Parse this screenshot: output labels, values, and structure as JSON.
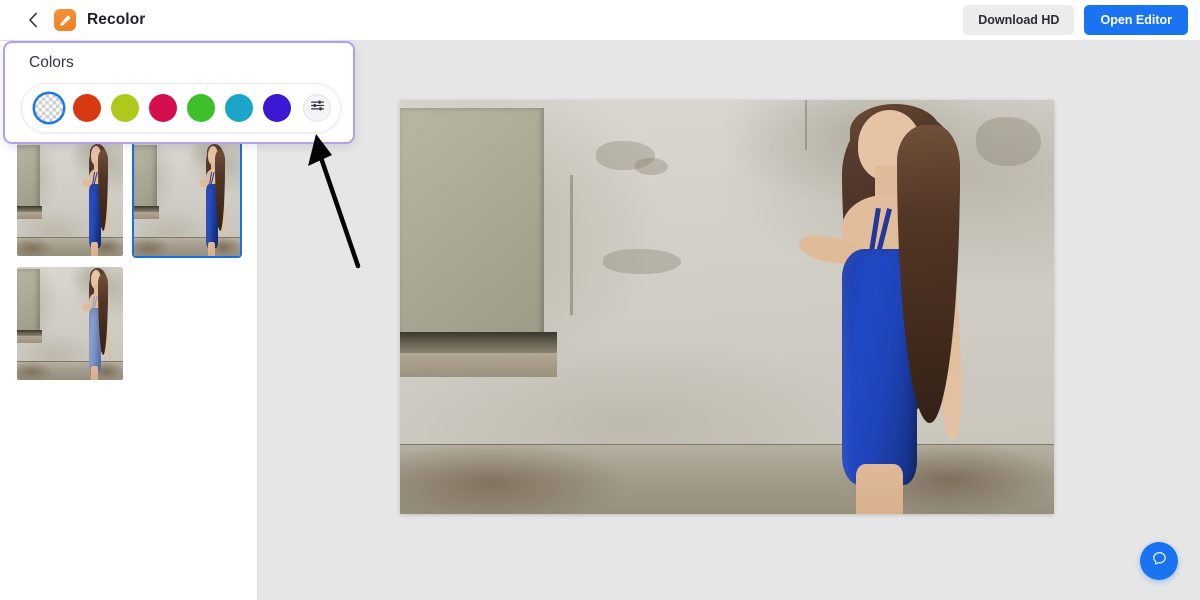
{
  "header": {
    "back_icon": "chevron-left-icon",
    "logo_icon": "paint-brush-icon",
    "app_title": "Recolor",
    "download_label": "Download HD",
    "open_editor_label": "Open Editor",
    "primary_color": "#1a73f0",
    "secondary_bg": "#ececec",
    "logo_color": "#ef7e24"
  },
  "colors_panel": {
    "title": "Colors",
    "border_color": "#b49ef0",
    "settings_icon": "sliders-icon",
    "selected_index": 0,
    "swatches": [
      {
        "name": "transparent",
        "hex": "transparent",
        "selected": true
      },
      {
        "name": "red-orange",
        "hex": "#d73a12",
        "selected": false
      },
      {
        "name": "yellow-green",
        "hex": "#aec91b",
        "selected": false
      },
      {
        "name": "crimson-pink",
        "hex": "#d50f4e",
        "selected": false
      },
      {
        "name": "green",
        "hex": "#3cbf28",
        "selected": false
      },
      {
        "name": "cyan-blue",
        "hex": "#1ba5c8",
        "selected": false
      },
      {
        "name": "violet-blue",
        "hex": "#3d18d2",
        "selected": false
      }
    ]
  },
  "sidebar": {
    "thumbnails": [
      {
        "name": "thumbnail-1",
        "dress_color": "#1f44bb",
        "selected": false
      },
      {
        "name": "thumbnail-2",
        "dress_color": "#1f44bb",
        "selected": true
      },
      {
        "name": "thumbnail-3",
        "dress_color": "#8098d6",
        "selected": false
      }
    ],
    "selection_color": "#1a6fe0"
  },
  "canvas": {
    "background": "#e6e6e6",
    "main_image_name": "woman-in-blue-dress-against-wall",
    "main_dress_color": "#1f44bb"
  },
  "annotation": {
    "arrow_name": "pointer-arrow",
    "arrow_color": "#000000",
    "points_to": "sliders-icon"
  },
  "help": {
    "icon": "chat-bubble-icon",
    "color": "#1a73f0"
  }
}
